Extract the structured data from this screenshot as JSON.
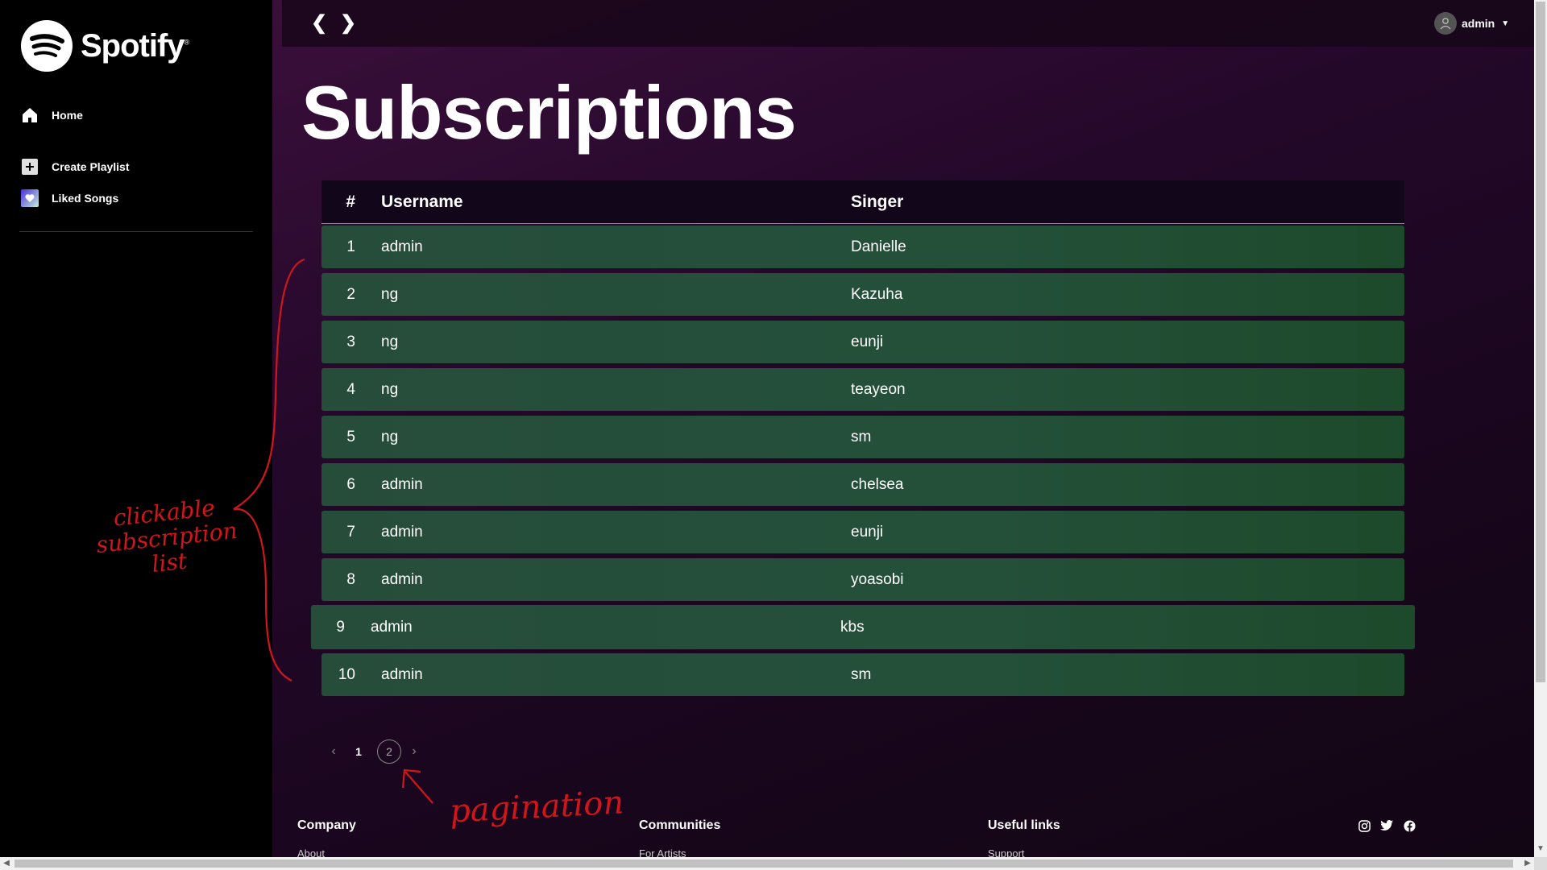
{
  "brand": {
    "name": "Spotify",
    "registered": "®"
  },
  "sidebar": {
    "items": [
      {
        "label": "Home",
        "icon": "home-icon"
      },
      {
        "label": "Create Playlist",
        "icon": "plus-square-icon"
      },
      {
        "label": "Liked Songs",
        "icon": "heart-icon"
      }
    ]
  },
  "header": {
    "back_label": "❮",
    "forward_label": "❯",
    "user": {
      "name": "admin"
    }
  },
  "page": {
    "title": "Subscriptions"
  },
  "table": {
    "columns": {
      "num": "#",
      "username": "Username",
      "singer": "Singer"
    },
    "rows": [
      {
        "num": "1",
        "username": "admin",
        "singer": "Danielle"
      },
      {
        "num": "2",
        "username": "ng",
        "singer": "Kazuha"
      },
      {
        "num": "3",
        "username": "ng",
        "singer": "eunji"
      },
      {
        "num": "4",
        "username": "ng",
        "singer": "teayeon"
      },
      {
        "num": "5",
        "username": "ng",
        "singer": "sm"
      },
      {
        "num": "6",
        "username": "admin",
        "singer": "chelsea"
      },
      {
        "num": "7",
        "username": "admin",
        "singer": "eunji"
      },
      {
        "num": "8",
        "username": "admin",
        "singer": "yoasobi"
      },
      {
        "num": "9",
        "username": "admin",
        "singer": "kbs"
      },
      {
        "num": "10",
        "username": "admin",
        "singer": "sm"
      }
    ]
  },
  "pagination": {
    "prev": "‹",
    "next": "›",
    "pages": [
      "1",
      "2"
    ],
    "current": "1"
  },
  "footer": {
    "columns": [
      {
        "title": "Company",
        "link": "About"
      },
      {
        "title": "Communities",
        "link": "For Artists"
      },
      {
        "title": "Useful links",
        "link": "Support"
      }
    ]
  },
  "annotations": {
    "list_note": "clickable subscription list",
    "pagination_note": "pagination"
  },
  "colors": {
    "row_bg": "#264d3a",
    "accent": "#1db954",
    "annotation": "#d0161b"
  }
}
